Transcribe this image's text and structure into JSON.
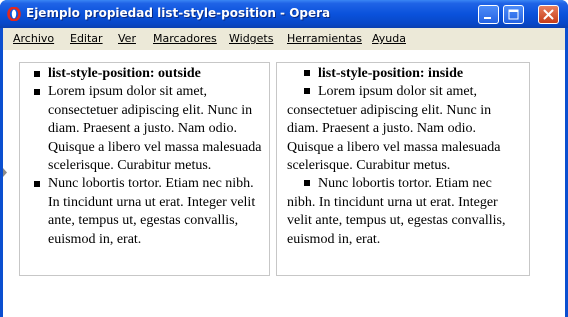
{
  "window": {
    "title": "Ejemplo propiedad list-style-position - Opera"
  },
  "menubar": {
    "items": [
      "Archivo",
      "Editar",
      "Ver",
      "Marcadores",
      "Widgets",
      "Herramientas",
      "Ayuda"
    ]
  },
  "left_list": {
    "items": [
      "list-style-position: outside",
      "Lorem ipsum dolor sit amet, consectetuer adipiscing elit. Nunc in diam. Praesent a justo. Nam odio. Quisque a libero vel massa malesuada scelerisque. Curabitur metus.",
      "Nunc lobortis tortor. Etiam nec nibh. In tincidunt urna ut erat. Integer velit ante, tempus ut, egestas convallis, euismod in, erat."
    ]
  },
  "right_list": {
    "items": [
      "list-style-position: inside",
      "Lorem ipsum dolor sit amet, consectetuer adipiscing elit. Nunc in diam. Praesent a justo. Nam odio. Quisque a libero vel massa malesuada scelerisque. Curabitur metus.",
      "Nunc lobortis tortor. Etiam nec nibh. In tincidunt urna ut erat. Integer velit ante, tempus ut, egestas convallis, euismod in, erat."
    ]
  },
  "colors": {
    "titlebar": "#0a52dc",
    "menubar": "#ece9d8",
    "close_button": "#c63c18",
    "box_border": "#c7c7c7"
  }
}
